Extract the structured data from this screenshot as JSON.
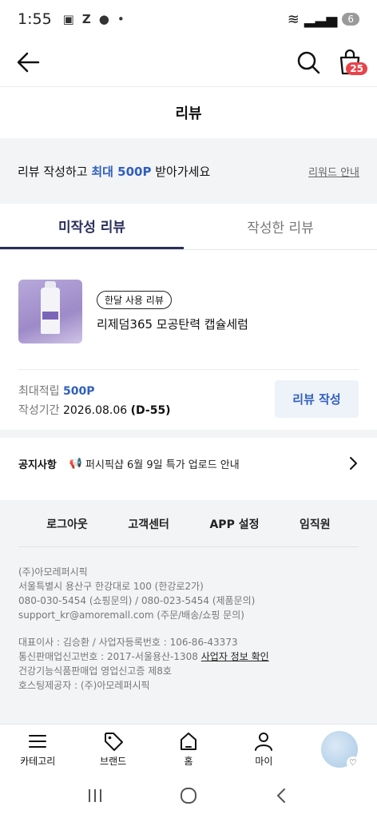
{
  "statusbar": {
    "time": "1:55",
    "icons": [
      "photo-icon",
      "z-icon",
      "talk-icon",
      "dot-icon"
    ],
    "battery": "6"
  },
  "header": {
    "cart_count": "25"
  },
  "page": {
    "title": "리뷰"
  },
  "banner": {
    "prefix": "리뷰 작성하고 ",
    "highlight": "최대 500P",
    "suffix": " 받아가세요",
    "link": "리워드 안내"
  },
  "tabs": [
    {
      "label": "미작성 리뷰",
      "active": true
    },
    {
      "label": "작성한 리뷰",
      "active": false
    }
  ],
  "product": {
    "tag": "한달 사용 리뷰",
    "name": "리제덤365 모공탄력 캡슐세럼"
  },
  "meta": {
    "points_label": "최대적립",
    "points_value": "500P",
    "period_label": "작성기간",
    "period_date": "2026.08.06",
    "period_dday": "(D-55)"
  },
  "review_button": "리뷰 작성",
  "notice": {
    "title": "공지사항",
    "content": "퍼시픽샵 6월 9일 특가 업로드 안내"
  },
  "footer": {
    "links": [
      "로그아웃",
      "고객센터",
      "APP 설정",
      "임직원"
    ],
    "company": "(주)아모레퍼시픽",
    "address": "서울특별시 용산구 한강대로 100 (한강로2가)",
    "phones": "080-030-5454 (쇼핑문의) / 080-023-5454 (제품문의)",
    "email": "support_kr@amoremall.com (주문/배송/쇼핑 문의)",
    "ceo": "대표이사 : 김승환 / 사업자등록번호 : 106-86-43373",
    "mail_order_prefix": "통신판매업신고번호 : 2017-서울용산-1308  ",
    "biz_info_link": "사업자 정보 확인",
    "health": "건강기능식품판매업 영업신고증 제8호",
    "hosting": "호스팅제공자 : (주)아모레퍼시픽"
  },
  "bottom_nav": [
    {
      "label": "카테고리",
      "icon": "menu-icon"
    },
    {
      "label": "브랜드",
      "icon": "tag-icon"
    },
    {
      "label": "홈",
      "icon": "home-icon"
    },
    {
      "label": "마이",
      "icon": "person-icon"
    }
  ]
}
